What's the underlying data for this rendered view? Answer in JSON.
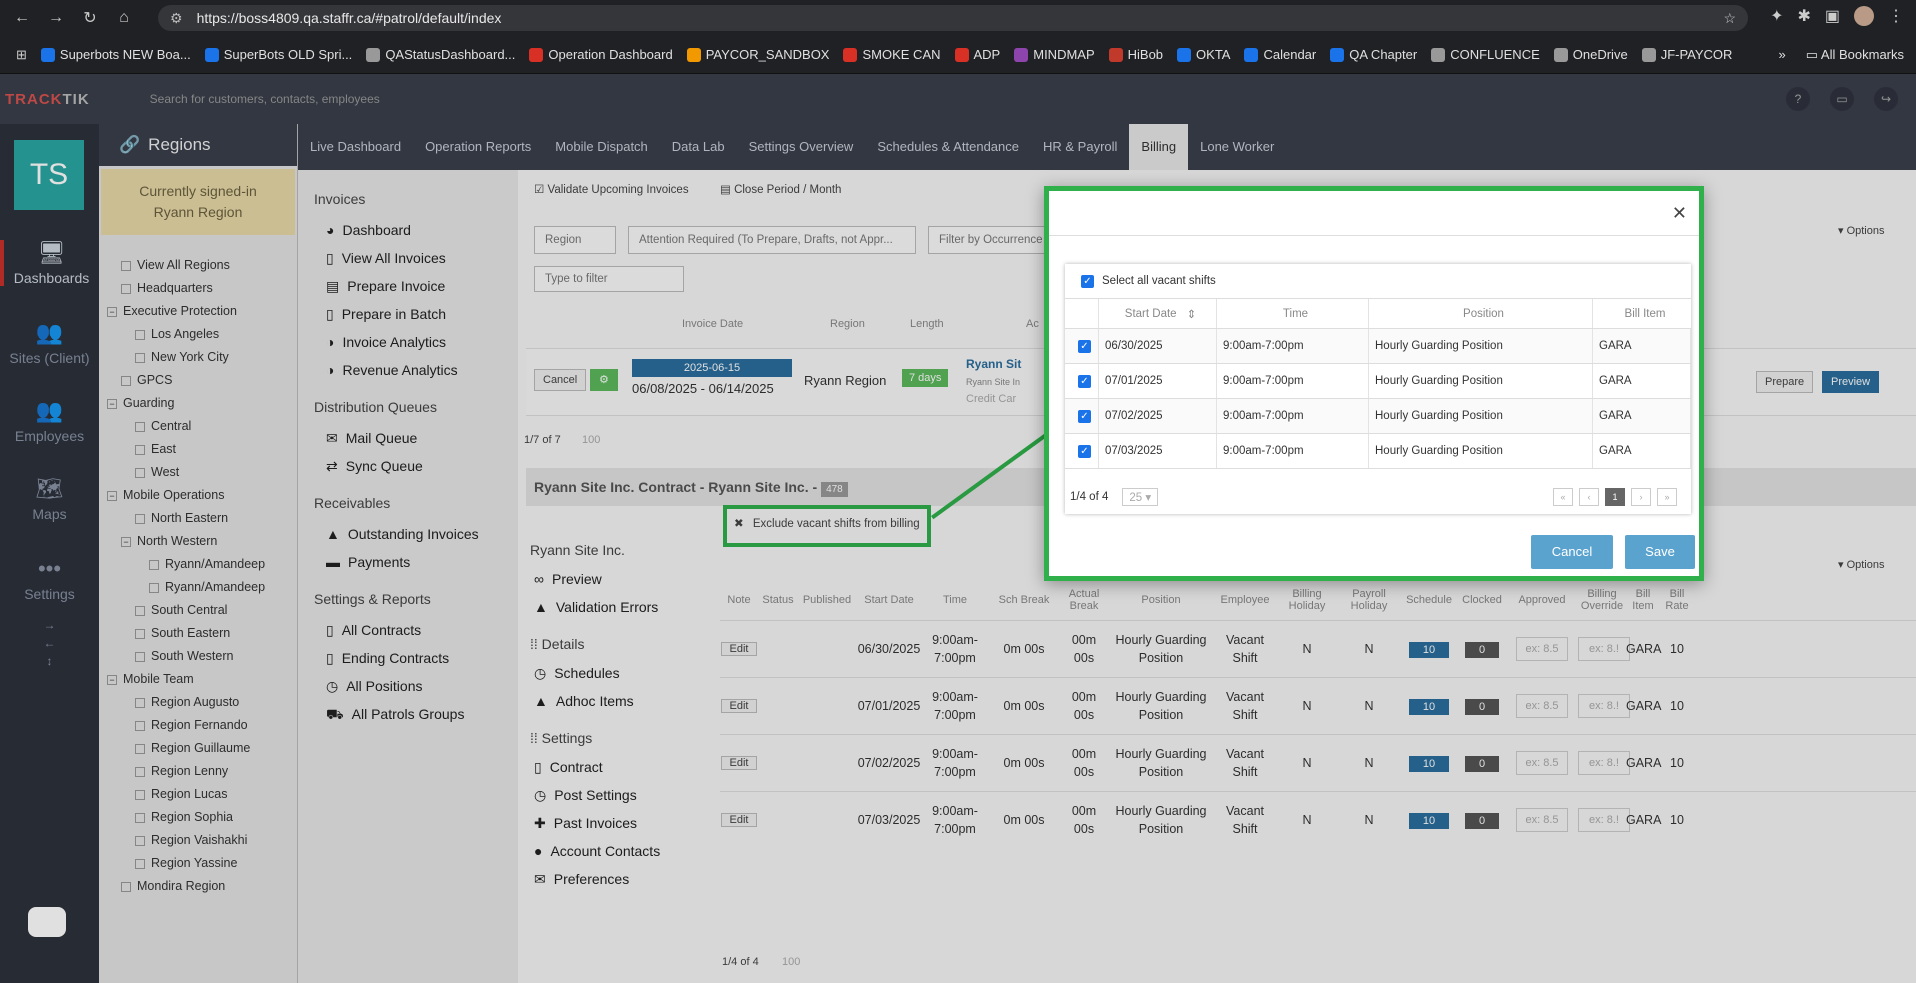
{
  "browser": {
    "url": "https://boss4809.qa.staffr.ca/#patrol/default/index",
    "all_bookmarks": "All Bookmarks",
    "bookmarks": [
      {
        "label": "Superbots NEW Boa...",
        "color": "#1a73e8"
      },
      {
        "label": "SuperBots OLD Spri...",
        "color": "#1a73e8"
      },
      {
        "label": "QAStatusDashboard...",
        "color": "#999999"
      },
      {
        "label": "Operation Dashboard",
        "color": "#d93025"
      },
      {
        "label": "PAYCOR_SANDBOX",
        "color": "#f29900"
      },
      {
        "label": "SMOKE CAN",
        "color": "#d93025"
      },
      {
        "label": "ADP",
        "color": "#d93025"
      },
      {
        "label": "MINDMAP",
        "color": "#8e44ad"
      },
      {
        "label": "HiBob",
        "color": "#c0392b"
      },
      {
        "label": "OKTA",
        "color": "#1a73e8"
      },
      {
        "label": "Calendar",
        "color": "#1a73e8"
      },
      {
        "label": "QA Chapter",
        "color": "#1a73e8"
      },
      {
        "label": "CONFLUENCE",
        "color": "#999999"
      },
      {
        "label": "OneDrive",
        "color": "#999999"
      },
      {
        "label": "JF-PAYCOR",
        "color": "#999999"
      }
    ]
  },
  "app": {
    "logo_a": "TRACK",
    "logo_b": "TIK",
    "search_placeholder": "Search for customers, contacts, employees",
    "avatar_initials": "TS"
  },
  "rail": [
    {
      "label": "Dashboards",
      "icon": "monitor-icon"
    },
    {
      "label": "Sites (Client)",
      "icon": "people-icon"
    },
    {
      "label": "Employees",
      "icon": "people-icon"
    },
    {
      "label": "Maps",
      "icon": "map-icon"
    },
    {
      "label": "Settings",
      "icon": "dots-icon"
    }
  ],
  "regions": {
    "title": "Regions",
    "signed_line1": "Currently signed-in",
    "signed_line2": "Ryann Region",
    "tree": [
      "View All Regions",
      "Headquarters",
      "Executive Protection",
      "Los Angeles",
      "New York City",
      "GPCS",
      "Guarding",
      "Central",
      "East",
      "West",
      "Mobile Operations",
      "North Eastern",
      "North Western",
      "Ryann/Amandeep",
      "Ryann/Amandeep",
      "South Central",
      "South Eastern",
      "South Western",
      "Mobile Team",
      "Region Augusto",
      "Region Fernando",
      "Region Guillaume",
      "Region Lenny",
      "Region Lucas",
      "Region Sophia",
      "Region Vaishakhi",
      "Region Yassine",
      "Mondira Region"
    ]
  },
  "main_nav": [
    "Live Dashboard",
    "Operation Reports",
    "Mobile Dispatch",
    "Data Lab",
    "Settings Overview",
    "Schedules & Attendance",
    "HR & Payroll",
    "Billing",
    "Lone Worker"
  ],
  "sub_menu": {
    "invoices": "Invoices",
    "inv_items": [
      "Dashboard",
      "View All Invoices",
      "Prepare Invoice",
      "Prepare in Batch",
      "Invoice Analytics",
      "Revenue Analytics"
    ],
    "queues": "Distribution Queues",
    "queue_items": [
      "Mail Queue",
      "Sync Queue"
    ],
    "receivables": "Receivables",
    "rec_items": [
      "Outstanding Invoices",
      "Payments"
    ],
    "settings": "Settings & Reports",
    "set_items": [
      "All Contracts",
      "Ending Contracts",
      "All Positions",
      "All Patrols Groups"
    ]
  },
  "toolbar": {
    "validate": "Validate Upcoming Invoices",
    "close_period": "Close Period / Month",
    "region": "Region",
    "attention": "Attention Required (To Prepare, Drafts, not Appr...",
    "occurrence": "Filter by Occurrence",
    "filter_ph": "Type to filter",
    "options": "Options"
  },
  "invoice_table": {
    "h_date": "Invoice Date",
    "h_region": "Region",
    "h_length": "Length",
    "h_ac": "Ac",
    "cancel": "Cancel",
    "date_badge": "2025-06-15",
    "date_range": "06/08/2025 - 06/14/2025",
    "region": "Ryann Region",
    "length": "7 days",
    "site": "Ryann Sit",
    "site_sub": "Ryann Site In",
    "credit": "Credit Car",
    "prepare": "Prepare",
    "preview": "Preview",
    "count": "1/7 of 7",
    "per": "100"
  },
  "contract": {
    "title": "Ryann Site Inc. Contract - Ryann Site Inc. - ",
    "badge": "478",
    "exclude": "Exclude vacant shifts from billing",
    "client": "Ryann Site Inc.",
    "preview": "Preview",
    "validation": "Validation Errors",
    "details": "Details",
    "schedules": "Schedules",
    "adhoc": "Adhoc Items",
    "settings": "Settings",
    "contract": "Contract",
    "post": "Post Settings",
    "past": "Past Invoices",
    "account": "Account Contacts",
    "prefs": "Preferences",
    "options": "Options",
    "count": "1/4 of 4",
    "per": "100"
  },
  "shift_grid": {
    "headers": [
      "Note",
      "Status",
      "Published",
      "Start Date",
      "Time",
      "Sch Break",
      "Actual Break",
      "Position",
      "Employee",
      "Billing Holiday",
      "Payroll Holiday",
      "Schedule",
      "Clocked",
      "Approved",
      "Billing Override",
      "Bill Item",
      "Bill Rate"
    ],
    "rows": [
      {
        "edit": "Edit",
        "date": "06/30/2025",
        "time1": "9:00am-",
        "time2": "7:00pm",
        "sch": "0m 00s",
        "act1": "00m",
        "act2": "00s",
        "pos1": "Hourly Guarding",
        "pos2": "Position",
        "emp1": "Vacant",
        "emp2": "Shift",
        "bh": "N",
        "ph": "N",
        "sched": "10",
        "clock": "0",
        "appr": "ex: 8.5",
        "ovr": "ex: 8.!",
        "item": "GARA",
        "rate": "10"
      },
      {
        "edit": "Edit",
        "date": "07/01/2025",
        "time1": "9:00am-",
        "time2": "7:00pm",
        "sch": "0m 00s",
        "act1": "00m",
        "act2": "00s",
        "pos1": "Hourly Guarding",
        "pos2": "Position",
        "emp1": "Vacant",
        "emp2": "Shift",
        "bh": "N",
        "ph": "N",
        "sched": "10",
        "clock": "0",
        "appr": "ex: 8.5",
        "ovr": "ex: 8.!",
        "item": "GARA",
        "rate": "10"
      },
      {
        "edit": "Edit",
        "date": "07/02/2025",
        "time1": "9:00am-",
        "time2": "7:00pm",
        "sch": "0m 00s",
        "act1": "00m",
        "act2": "00s",
        "pos1": "Hourly Guarding",
        "pos2": "Position",
        "emp1": "Vacant",
        "emp2": "Shift",
        "bh": "N",
        "ph": "N",
        "sched": "10",
        "clock": "0",
        "appr": "ex: 8.5",
        "ovr": "ex: 8.!",
        "item": "GARA",
        "rate": "10"
      },
      {
        "edit": "Edit",
        "date": "07/03/2025",
        "time1": "9:00am-",
        "time2": "7:00pm",
        "sch": "0m 00s",
        "act1": "00m",
        "act2": "00s",
        "pos1": "Hourly Guarding",
        "pos2": "Position",
        "emp1": "Vacant",
        "emp2": "Shift",
        "bh": "N",
        "ph": "N",
        "sched": "10",
        "clock": "0",
        "appr": "ex: 8.5",
        "ovr": "ex: 8.!",
        "item": "GARA",
        "rate": "10"
      }
    ]
  },
  "modal": {
    "select_all": "Select all vacant shifts",
    "headers": [
      "Start Date",
      "Time",
      "Position",
      "Bill Item"
    ],
    "rows": [
      {
        "date": "06/30/2025",
        "time": "9:00am-7:00pm",
        "position": "Hourly Guarding Position",
        "item": "GARA"
      },
      {
        "date": "07/01/2025",
        "time": "9:00am-7:00pm",
        "position": "Hourly Guarding Position",
        "item": "GARA"
      },
      {
        "date": "07/02/2025",
        "time": "9:00am-7:00pm",
        "position": "Hourly Guarding Position",
        "item": "GARA"
      },
      {
        "date": "07/03/2025",
        "time": "9:00am-7:00pm",
        "position": "Hourly Guarding Position",
        "item": "GARA"
      }
    ],
    "count": "1/4 of 4",
    "per": "25",
    "page": "1",
    "cancel": "Cancel",
    "save": "Save"
  }
}
